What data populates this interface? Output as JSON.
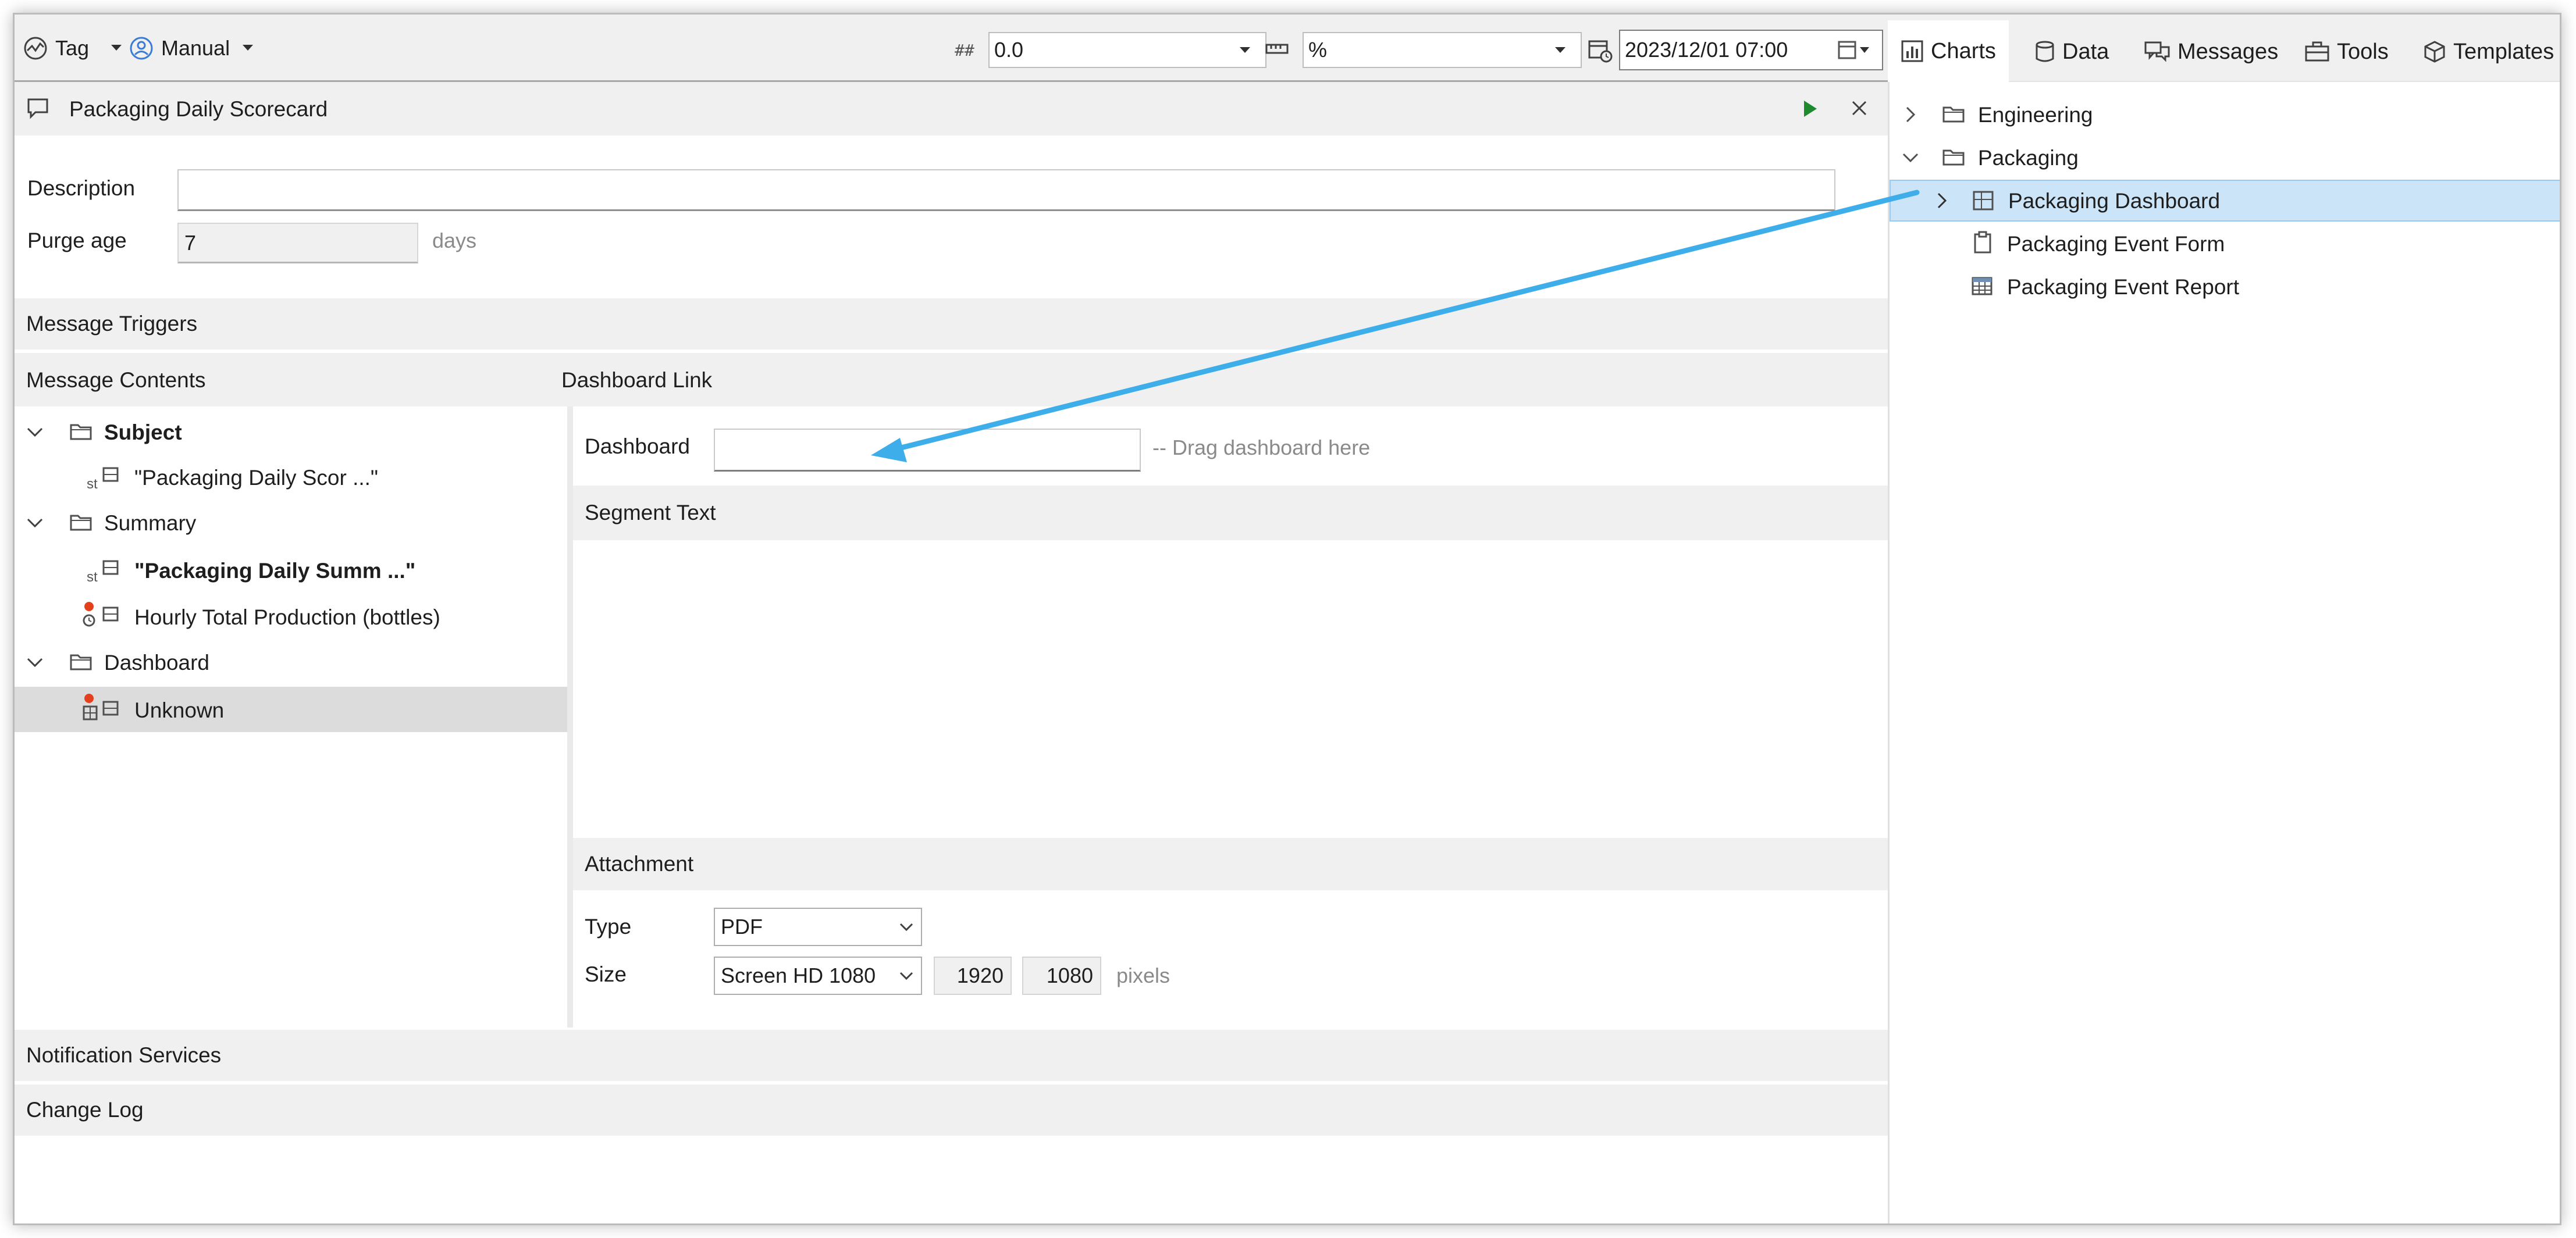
{
  "toolbar": {
    "tag_label": "Tag",
    "manual_label": "Manual",
    "precision_glyph": "##",
    "precision_value": "0.0",
    "unit_value": "%",
    "datetime_value": "2023/12/01 07:00"
  },
  "right_tabs": [
    {
      "label": "Charts",
      "icon": "bar-chart-icon",
      "active": true
    },
    {
      "label": "Data",
      "icon": "database-icon"
    },
    {
      "label": "Messages",
      "icon": "messages-icon"
    },
    {
      "label": "Tools",
      "icon": "toolbox-icon"
    },
    {
      "label": "Templates",
      "icon": "cube-icon"
    }
  ],
  "tree": [
    {
      "label": "Engineering",
      "expanded": false,
      "icon": "folder-icon"
    },
    {
      "label": "Packaging",
      "expanded": true,
      "icon": "folder-icon"
    },
    {
      "label": "Packaging Dashboard",
      "selected": true,
      "icon": "dashboard-icon"
    },
    {
      "label": "Packaging Event Form",
      "icon": "clipboard-icon"
    },
    {
      "label": "Packaging Event Report",
      "icon": "table-icon"
    }
  ],
  "editor": {
    "title": "Packaging Daily Scorecard",
    "description_label": "Description",
    "description_value": "",
    "purge_label": "Purge age",
    "purge_value": "7",
    "purge_unit": "days",
    "message_triggers": "Message Triggers",
    "message_contents": "Message Contents",
    "dashboard_link": "Dashboard Link",
    "notification_services": "Notification Services",
    "change_log": "Change Log"
  },
  "contents_tree": [
    {
      "label": "Subject",
      "bold": true,
      "type": "group"
    },
    {
      "label": "\"Packaging Daily Scor ...\"",
      "type": "string",
      "type_tag": "st"
    },
    {
      "label": "Summary",
      "type": "group"
    },
    {
      "label": "\"Packaging Daily Summ ...\"",
      "bold": true,
      "type": "string",
      "type_tag": "st"
    },
    {
      "label": "Hourly Total Production (bottles)",
      "type": "tag"
    },
    {
      "label": "Dashboard",
      "type": "group"
    },
    {
      "label": "Unknown",
      "type": "dashboard",
      "selected": true
    }
  ],
  "dashboard_link": {
    "dashboard_label": "Dashboard",
    "dashboard_value": "",
    "drag_hint": "-- Drag dashboard here",
    "segment_text_label": "Segment Text",
    "attachment_label": "Attachment",
    "type_label": "Type",
    "type_value": "PDF",
    "size_label": "Size",
    "size_value": "Screen HD 1080",
    "width_value": "1920",
    "height_value": "1080",
    "size_unit": "pixels"
  },
  "colors": {
    "accent_arrow": "#3daee9",
    "selection": "#cce4f7",
    "play_green": "#1e8a2e",
    "warning_red": "#e5401c"
  }
}
